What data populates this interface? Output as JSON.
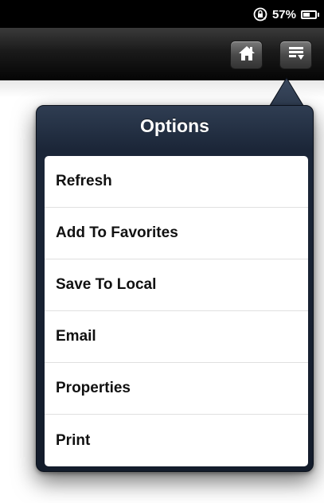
{
  "status_bar": {
    "battery_text": "57%",
    "battery_level": 0.57,
    "icons": [
      "rotation-lock-icon",
      "battery-icon"
    ]
  },
  "nav_bar": {
    "buttons": [
      {
        "name": "home-button",
        "icon": "home-icon"
      },
      {
        "name": "options-menu-button",
        "icon": "menu-list-icon"
      }
    ]
  },
  "popover": {
    "title": "Options",
    "items": [
      {
        "label": "Refresh"
      },
      {
        "label": "Add To Favorites"
      },
      {
        "label": "Save To Local"
      },
      {
        "label": "Email"
      },
      {
        "label": "Properties"
      },
      {
        "label": "Print"
      }
    ]
  },
  "colors": {
    "status_bar_bg": "#000000",
    "popover_frame": "#1b2638",
    "menu_bg": "#ffffff"
  }
}
